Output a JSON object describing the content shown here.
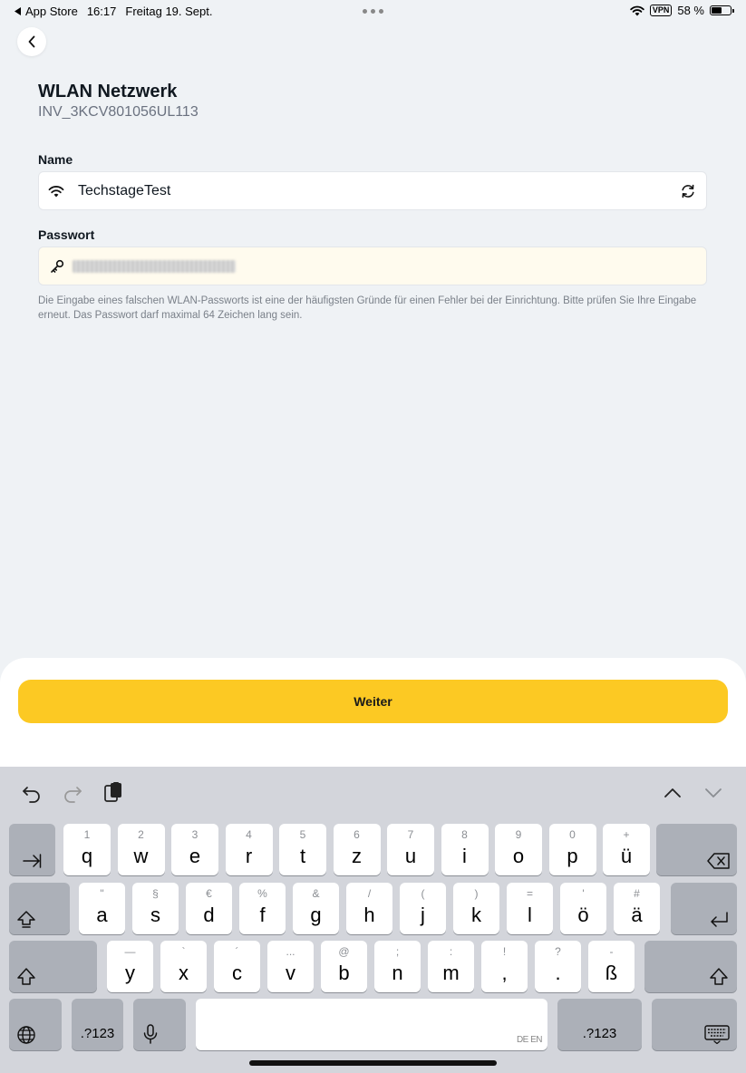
{
  "status_bar": {
    "back_app": "App Store",
    "time": "16:17",
    "date": "Freitag 19. Sept.",
    "vpn": "VPN",
    "battery": "58 %",
    "battery_level": 0.58
  },
  "header": {
    "title": "WLAN Netzwerk",
    "subtitle": "INV_3KCV801056UL113"
  },
  "form": {
    "name_label": "Name",
    "name_value": "TechstageTest",
    "password_label": "Passwort",
    "hint": "Die Eingabe eines falschen WLAN-Passworts ist eine der häufigsten Gründe für einen Fehler bei der Einrichtung. Bitte prüfen Sie Ihre Eingabe erneut. Das Passwort darf maximal 64 Zeichen lang sein."
  },
  "action": {
    "weiter_label": "Weiter"
  },
  "keyboard": {
    "row1": [
      {
        "hint": "1",
        "char": "q"
      },
      {
        "hint": "2",
        "char": "w"
      },
      {
        "hint": "3",
        "char": "e"
      },
      {
        "hint": "4",
        "char": "r"
      },
      {
        "hint": "5",
        "char": "t"
      },
      {
        "hint": "6",
        "char": "z"
      },
      {
        "hint": "7",
        "char": "u"
      },
      {
        "hint": "8",
        "char": "i"
      },
      {
        "hint": "9",
        "char": "o"
      },
      {
        "hint": "0",
        "char": "p"
      },
      {
        "hint": "+",
        "char": "ü"
      }
    ],
    "row2": [
      {
        "hint": "\"",
        "char": "a"
      },
      {
        "hint": "§",
        "char": "s"
      },
      {
        "hint": "€",
        "char": "d"
      },
      {
        "hint": "%",
        "char": "f"
      },
      {
        "hint": "&",
        "char": "g"
      },
      {
        "hint": "/",
        "char": "h"
      },
      {
        "hint": "(",
        "char": "j"
      },
      {
        "hint": ")",
        "char": "k"
      },
      {
        "hint": "=",
        "char": "l"
      },
      {
        "hint": "'",
        "char": "ö"
      },
      {
        "hint": "#",
        "char": "ä"
      }
    ],
    "row3": [
      {
        "hint": "—",
        "char": "y"
      },
      {
        "hint": "`",
        "char": "x"
      },
      {
        "hint": "´",
        "char": "c"
      },
      {
        "hint": "...",
        "char": "v"
      },
      {
        "hint": "@",
        "char": "b"
      },
      {
        "hint": ";",
        "char": "n"
      },
      {
        "hint": ":",
        "char": "m"
      },
      {
        "hint": "!",
        "char": ","
      },
      {
        "hint": "?",
        "char": "."
      },
      {
        "hint": "-",
        "char": "ß"
      }
    ],
    "numbers_left": ".?123",
    "numbers_right": ".?123",
    "space_lang": "DE EN"
  }
}
